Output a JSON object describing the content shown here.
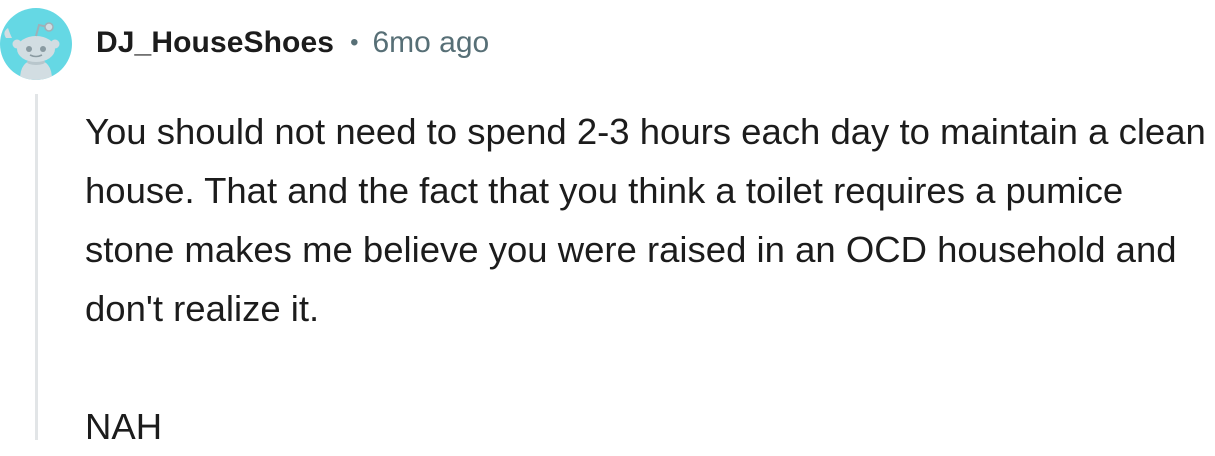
{
  "comment": {
    "avatar_icon": "reddit-snoo-avatar-icon",
    "username": "DJ_HouseShoes",
    "separator": "•",
    "timestamp": "6mo ago",
    "paragraphs": [
      "You should not need to spend 2-3 hours each day to maintain a clean house. That and the fact that you think a toilet requires a pumice stone makes me believe you were raised in an OCD household and don't realize it.",
      "NAH"
    ]
  },
  "colors": {
    "avatar_bg": "#65d8e4",
    "username": "#1c1c1c",
    "meta": "#576f76",
    "thread_line": "#e2e5e7",
    "text": "#1c1c1c"
  }
}
